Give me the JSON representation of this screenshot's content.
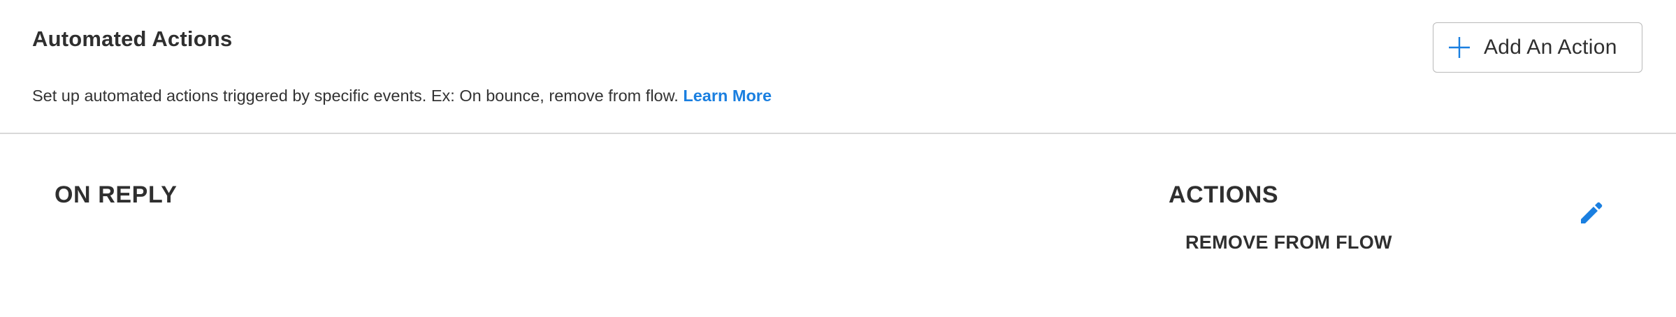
{
  "header": {
    "title": "Automated Actions",
    "description": "Set up automated actions triggered by specific events. Ex: On bounce, remove from flow.",
    "learn_more_label": "Learn More",
    "add_action_label": "Add An Action",
    "add_icon": "plus-icon"
  },
  "rule": {
    "trigger_heading": "ON REPLY",
    "actions_heading": "ACTIONS",
    "actions": [
      "REMOVE FROM FLOW"
    ],
    "edit_icon": "pencil-icon"
  },
  "colors": {
    "accent": "#1a7fe0",
    "text": "#2f2f2f",
    "divider": "#d8d8d8",
    "button_border": "#b9b9b9"
  }
}
